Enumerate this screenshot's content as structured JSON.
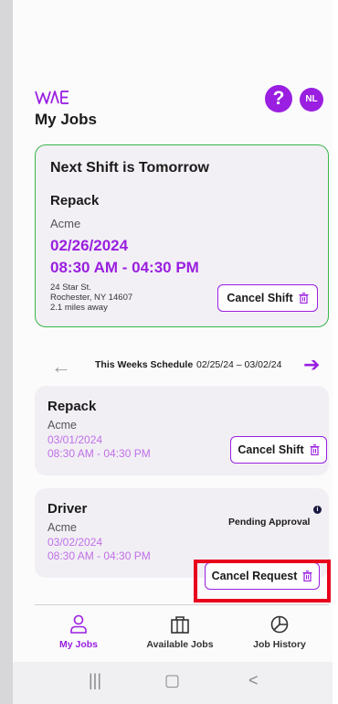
{
  "header": {
    "logo_text": "WAE",
    "help_label": "?",
    "avatar_initials": "NL"
  },
  "page_title": "My Jobs",
  "next_shift": {
    "heading": "Next Shift is Tomorrow",
    "job": "Repack",
    "company": "Acme",
    "date": "02/26/2024",
    "time": "08:30 AM - 04:30 PM",
    "address_line1": "24 Star St.",
    "address_line2": "Rochester, NY 14607",
    "distance": "2.1 miles away",
    "button_label": "Cancel Shift"
  },
  "week_nav": {
    "label": "This Weeks Schedule",
    "range": "02/25/24 – 03/02/24",
    "prev_icon": "arrow-left-icon",
    "next_icon": "arrow-right-icon"
  },
  "schedule": [
    {
      "job": "Repack",
      "company": "Acme",
      "date": "03/01/2024",
      "time": "08:30 AM - 04:30 PM",
      "button_label": "Cancel Shift"
    },
    {
      "job": "Driver",
      "company": "Acme",
      "date": "03/02/2024",
      "time": "08:30 AM - 04:30 PM",
      "status": "Pending Approval",
      "status_info": "i",
      "button_label": "Cancel Request"
    }
  ],
  "bottom_nav": [
    {
      "label": "My Jobs",
      "icon": "person-icon",
      "active": true
    },
    {
      "label": "Available Jobs",
      "icon": "briefcase-icon",
      "active": false
    },
    {
      "label": "Job History",
      "icon": "history-chart-icon",
      "active": false
    }
  ],
  "system_nav": {
    "recents": "|||",
    "home": "▢",
    "back": "<"
  },
  "colors": {
    "accent": "#9a1fe0",
    "next_card_border": "#39b54a",
    "highlight": "#e8001c",
    "light_purple_text": "#c070e8"
  }
}
